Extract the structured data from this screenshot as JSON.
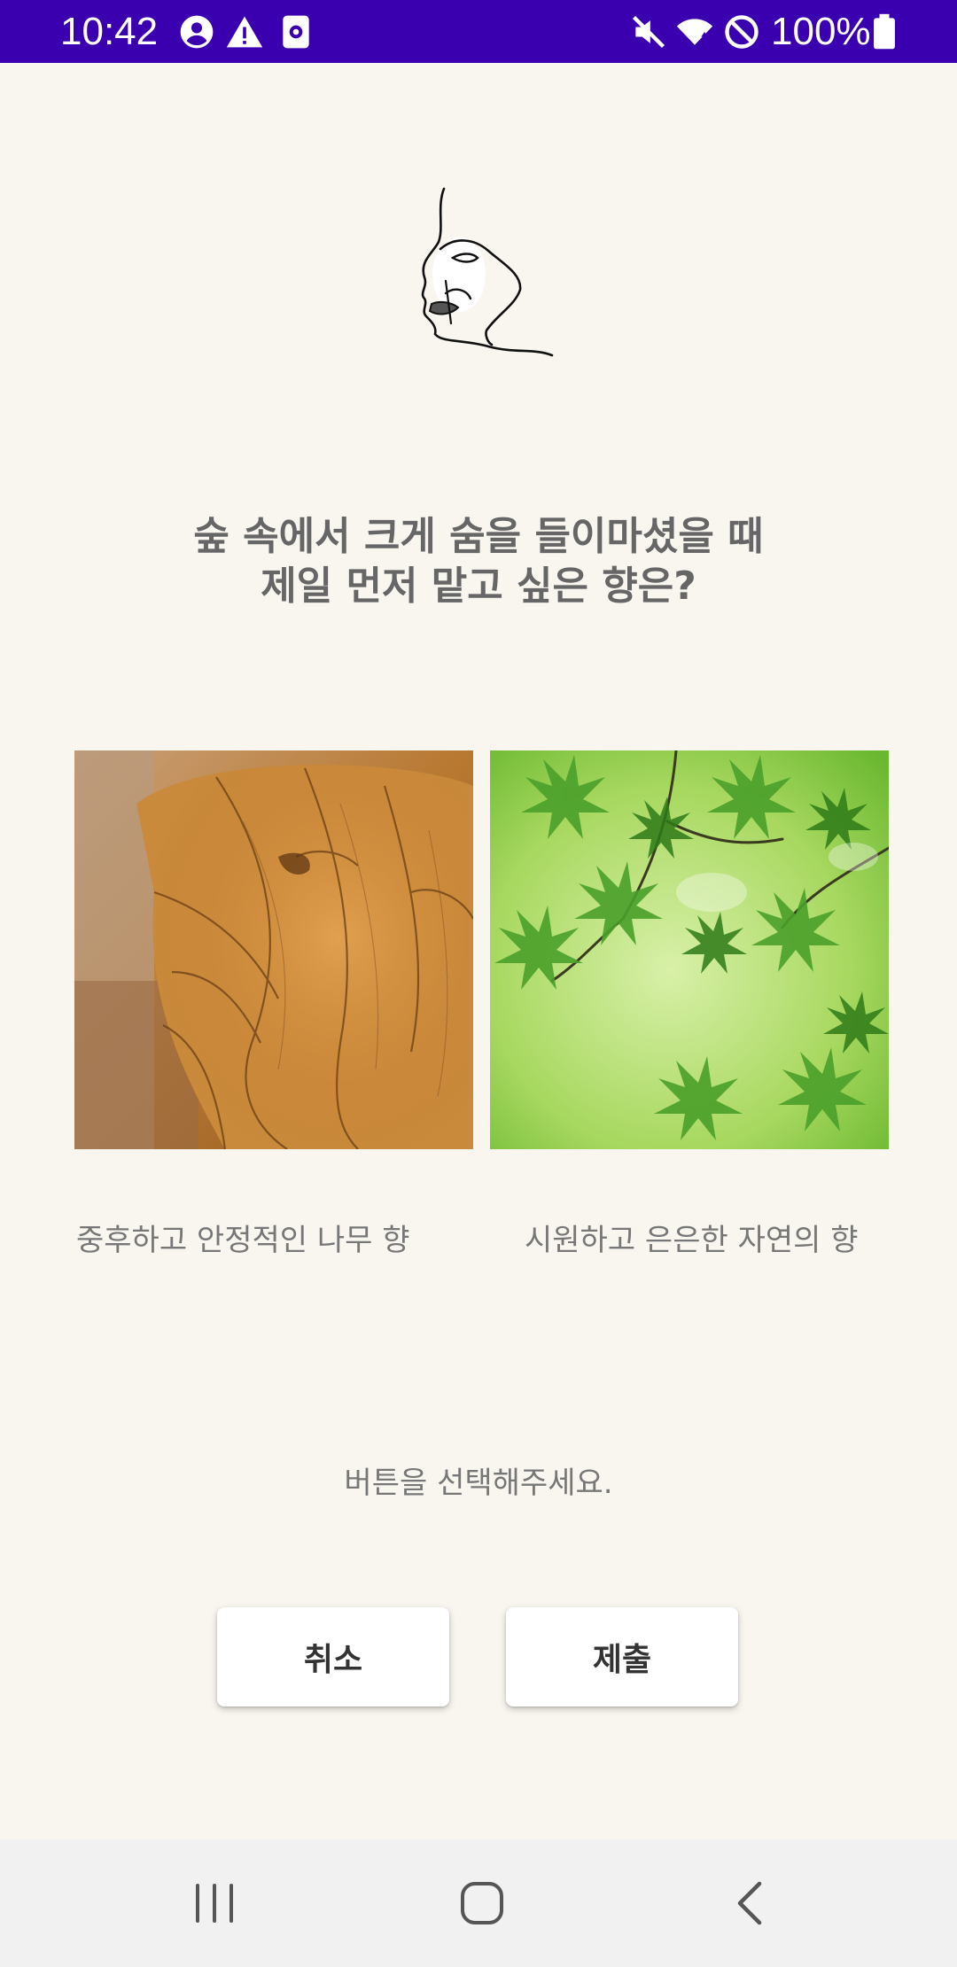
{
  "status_bar": {
    "time": "10:42",
    "battery": "100%",
    "icons_left": [
      "account-circle-icon",
      "warning-icon",
      "screen-record-icon"
    ],
    "icons_right": [
      "mute-icon",
      "wifi-icon",
      "do-not-disturb-icon",
      "battery-icon"
    ],
    "background": "#3a00b0"
  },
  "question": {
    "line1": "숲 속에서 크게 숨을 들이마셨을 때",
    "line2": "제일 먼저 맡고 싶은 향은?"
  },
  "choices": [
    {
      "label": "중후하고 안정적인 나무 향",
      "image": "wood-texture"
    },
    {
      "label": "시원하고 은은한 자연의 향",
      "image": "green-leaves"
    }
  ],
  "hint": "버튼을 선택해주세요.",
  "buttons": {
    "cancel": "취소",
    "submit": "제출"
  },
  "nav_bar": {
    "items": [
      "recent-apps-icon",
      "home-icon",
      "back-icon"
    ]
  }
}
